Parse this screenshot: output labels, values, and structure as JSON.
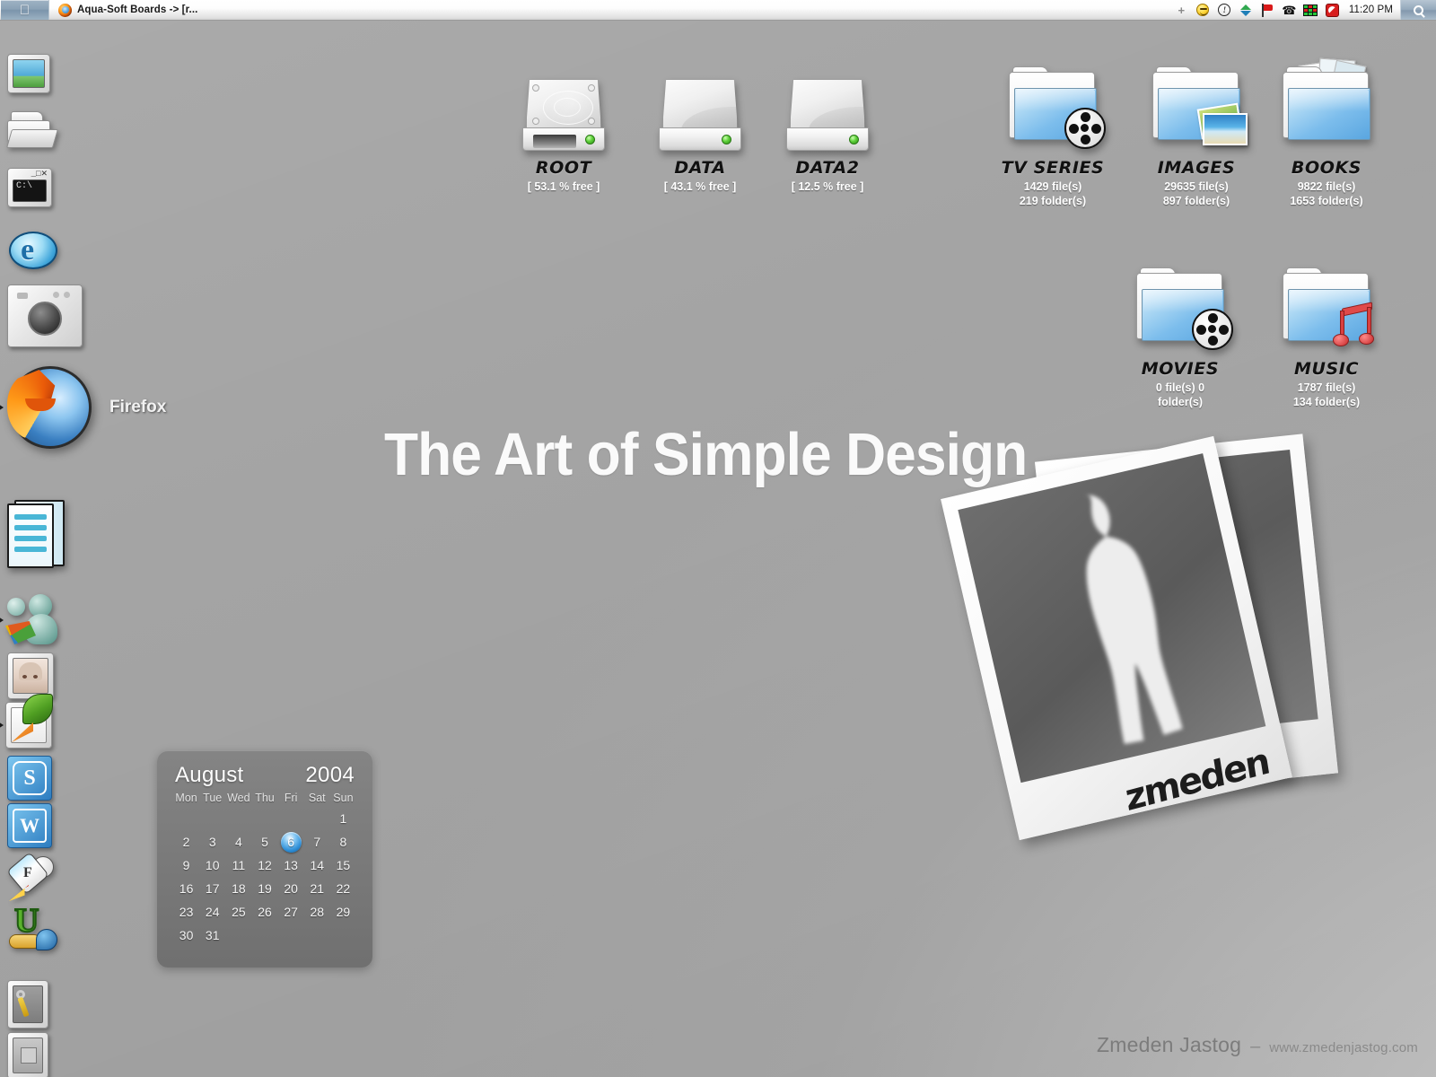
{
  "menubar": {
    "apple_logo": "",
    "window_title": "Aqua-Soft Boards -> [r...",
    "clock": "11:20 PM",
    "tray_icons": [
      {
        "name": "plus-icon",
        "glyph": "+"
      },
      {
        "name": "smiley-icon",
        "glyph": ""
      },
      {
        "name": "exclamation-circle-icon",
        "glyph": "!"
      },
      {
        "name": "up-down-arrows-icon",
        "glyph": ""
      },
      {
        "name": "flag-icon",
        "glyph": ""
      },
      {
        "name": "phone-icon",
        "glyph": "☎"
      },
      {
        "name": "network-bars-icon",
        "glyph": ""
      },
      {
        "name": "antivirus-icon",
        "glyph": ""
      }
    ],
    "spotlight_label": "search-icon"
  },
  "dock": {
    "items": [
      {
        "name": "display-settings",
        "label": "",
        "running": false
      },
      {
        "name": "file-explorer",
        "label": "",
        "running": false
      },
      {
        "name": "command-prompt",
        "label": "",
        "running": false
      },
      {
        "name": "internet-explorer",
        "label": "",
        "running": false
      },
      {
        "name": "camera",
        "label": "",
        "running": false
      },
      {
        "name": "firefox",
        "label": "Firefox",
        "running": true
      },
      {
        "name": "documents",
        "label": "",
        "running": false
      },
      {
        "name": "msn-messenger",
        "label": "",
        "running": true
      },
      {
        "name": "anime-avatar",
        "label": "",
        "running": false
      },
      {
        "name": "feather-editor",
        "label": "",
        "running": true
      },
      {
        "name": "studio-app",
        "label": "",
        "running": false
      },
      {
        "name": "word-processor",
        "label": "",
        "running": false
      },
      {
        "name": "flash-rocket",
        "label": "",
        "running": false
      },
      {
        "name": "utorrent",
        "label": "",
        "running": false
      },
      {
        "name": "tools",
        "label": "",
        "running": false
      },
      {
        "name": "trash",
        "label": "",
        "running": false
      }
    ]
  },
  "desktop": {
    "headline": "The Art of Simple Design",
    "drives": [
      {
        "name": "ROOT",
        "sub": "[ 53.1 % free ]",
        "free_percent": 53.1,
        "style": "hdd"
      },
      {
        "name": "DATA",
        "sub": "[ 43.1 % free ]",
        "free_percent": 43.1,
        "style": "plain"
      },
      {
        "name": "DATA2",
        "sub": "[ 12.5 % free ]",
        "free_percent": 12.5,
        "style": "plain"
      }
    ],
    "folders_row1": [
      {
        "name": "TV SERIES",
        "files": "1429 file(s)",
        "folders": "219 folder(s)",
        "badge": "film-reel"
      },
      {
        "name": "IMAGES",
        "files": "29635 file(s)",
        "folders": "897 folder(s)",
        "badge": "photos"
      },
      {
        "name": "BOOKS",
        "files": "9822 file(s)",
        "folders": "1653 folder(s)",
        "badge": "papers"
      }
    ],
    "folders_row2": [
      {
        "name": "MOVIES",
        "files": "0 file(s)   0",
        "folders": "folder(s)",
        "badge": "film-reel"
      },
      {
        "name": "MUSIC",
        "files": "1787 file(s)",
        "folders": "134 folder(s)",
        "badge": "music-note"
      }
    ]
  },
  "calendar": {
    "month": "August",
    "year": "2004",
    "dow": [
      "Mon",
      "Tue",
      "Wed",
      "Thu",
      "Fri",
      "Sat",
      "Sun"
    ],
    "leading_blanks": 6,
    "days": [
      1,
      2,
      3,
      4,
      5,
      6,
      7,
      8,
      9,
      10,
      11,
      12,
      13,
      14,
      15,
      16,
      17,
      18,
      19,
      20,
      21,
      22,
      23,
      24,
      25,
      26,
      27,
      28,
      29,
      30,
      31
    ],
    "today": 6
  },
  "polaroid": {
    "signature": "zmeden"
  },
  "footer": {
    "brand": "Zmeden Jastog",
    "separator": "–",
    "url": "www.zmedenjastog.com"
  },
  "colors": {
    "desktop_center": "#b0b0b0",
    "desktop_light": "#d2d2d2",
    "menubar_top": "#ffffff",
    "accent_blue": "#2e8ed6",
    "drive_led_green": "#5ed13a",
    "folder_blue": "#7cbdec",
    "music_red": "#d94040"
  }
}
